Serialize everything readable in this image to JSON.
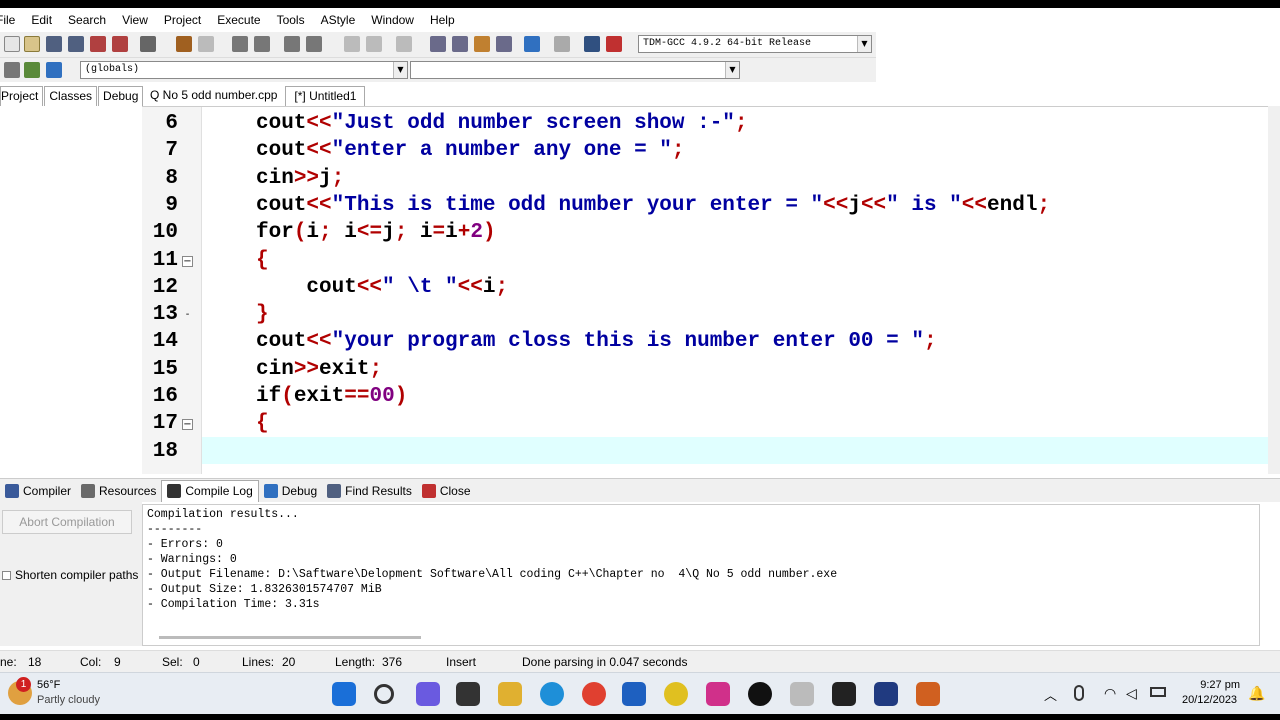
{
  "menu": [
    "File",
    "Edit",
    "Search",
    "View",
    "Project",
    "Execute",
    "Tools",
    "AStyle",
    "Window",
    "Help"
  ],
  "toolbar": {
    "compiler_select": "TDM-GCC 4.9.2 64-bit Release",
    "globals_select": "(globals)",
    "symbol_select": ""
  },
  "left_tabs": [
    "Project",
    "Classes",
    "Debug"
  ],
  "file_tabs": [
    "Q No 5 odd number.cpp",
    "[*] Untitled1"
  ],
  "code_lines": [
    {
      "n": "6",
      "parts": [
        [
          "kw",
          "cout"
        ],
        [
          "op",
          "<<"
        ],
        [
          "str",
          "\"Just odd number screen show :-\""
        ],
        [
          "op",
          ";"
        ]
      ]
    },
    {
      "n": "7",
      "parts": [
        [
          "kw",
          "cout"
        ],
        [
          "op",
          "<<"
        ],
        [
          "str",
          "\"enter a number any one = \""
        ],
        [
          "op",
          ";"
        ]
      ]
    },
    {
      "n": "8",
      "parts": [
        [
          "kw",
          "cin"
        ],
        [
          "op",
          ">>"
        ],
        [
          "kw",
          "j"
        ],
        [
          "op",
          ";"
        ]
      ]
    },
    {
      "n": "9",
      "parts": [
        [
          "kw",
          "cout"
        ],
        [
          "op",
          "<<"
        ],
        [
          "str",
          "\"This is time odd number your enter = \""
        ],
        [
          "op",
          "<<"
        ],
        [
          "kw",
          "j"
        ],
        [
          "op",
          "<<"
        ],
        [
          "str",
          "\" is \""
        ],
        [
          "op",
          "<<"
        ],
        [
          "kw",
          "endl"
        ],
        [
          "op",
          ";"
        ]
      ]
    },
    {
      "n": "10",
      "parts": [
        [
          "kw",
          "for"
        ],
        [
          "op",
          "("
        ],
        [
          "kw",
          "i"
        ],
        [
          "op",
          ";"
        ],
        [
          "kw",
          " i"
        ],
        [
          "op",
          "<="
        ],
        [
          "kw",
          "j"
        ],
        [
          "op",
          ";"
        ],
        [
          "kw",
          " i"
        ],
        [
          "op",
          "="
        ],
        [
          "kw",
          "i"
        ],
        [
          "op",
          "+"
        ],
        [
          "num",
          "2"
        ],
        [
          "op",
          ")"
        ]
      ]
    },
    {
      "n": "11",
      "parts": [
        [
          "op",
          "{"
        ]
      ]
    },
    {
      "n": "12",
      "parts": [
        [
          "kw",
          "    cout"
        ],
        [
          "op",
          "<<"
        ],
        [
          "str",
          "\" \\t \""
        ],
        [
          "op",
          "<<"
        ],
        [
          "kw",
          "i"
        ],
        [
          "op",
          ";"
        ]
      ]
    },
    {
      "n": "13",
      "parts": [
        [
          "op",
          "}"
        ]
      ]
    },
    {
      "n": "14",
      "parts": [
        [
          "kw",
          "cout"
        ],
        [
          "op",
          "<<"
        ],
        [
          "str",
          "\"your program closs this is number enter 00 = \""
        ],
        [
          "op",
          ";"
        ]
      ]
    },
    {
      "n": "15",
      "parts": [
        [
          "kw",
          "cin"
        ],
        [
          "op",
          ">>"
        ],
        [
          "kw",
          "exit"
        ],
        [
          "op",
          ";"
        ]
      ]
    },
    {
      "n": "16",
      "parts": [
        [
          "kw",
          "if"
        ],
        [
          "op",
          "("
        ],
        [
          "kw",
          "exit"
        ],
        [
          "op",
          "=="
        ],
        [
          "num",
          "00"
        ],
        [
          "op",
          ")"
        ]
      ]
    },
    {
      "n": "17",
      "parts": [
        [
          "op",
          "{"
        ]
      ]
    },
    {
      "n": "18",
      "parts": []
    }
  ],
  "bottom_tabs": [
    "Compiler",
    "Resources",
    "Compile Log",
    "Debug",
    "Find Results",
    "Close"
  ],
  "abort_label": "Abort Compilation",
  "shorten_label": "Shorten compiler paths",
  "log_lines": [
    "Compilation results...",
    "--------",
    "- Errors: 0",
    "- Warnings: 0",
    "- Output Filename: D:\\Saftware\\Delopment Software\\All coding C++\\Chapter no  4\\Q No 5 odd number.exe",
    "- Output Size: 1.8326301574707 MiB",
    "- Compilation Time: 3.31s"
  ],
  "status": {
    "line_label": "ne:",
    "line": "18",
    "col_label": "Col:",
    "col": "9",
    "sel_label": "Sel:",
    "sel": "0",
    "lines_label": "Lines:",
    "lines": "20",
    "length_label": "Length:",
    "length": "376",
    "mode": "Insert",
    "parse": "Done parsing in 0.047 seconds"
  },
  "taskbar": {
    "temp": "56°F",
    "weather": "Partly cloudy",
    "badge": "1",
    "time": "9:27 pm",
    "date": "20/12/2023"
  }
}
